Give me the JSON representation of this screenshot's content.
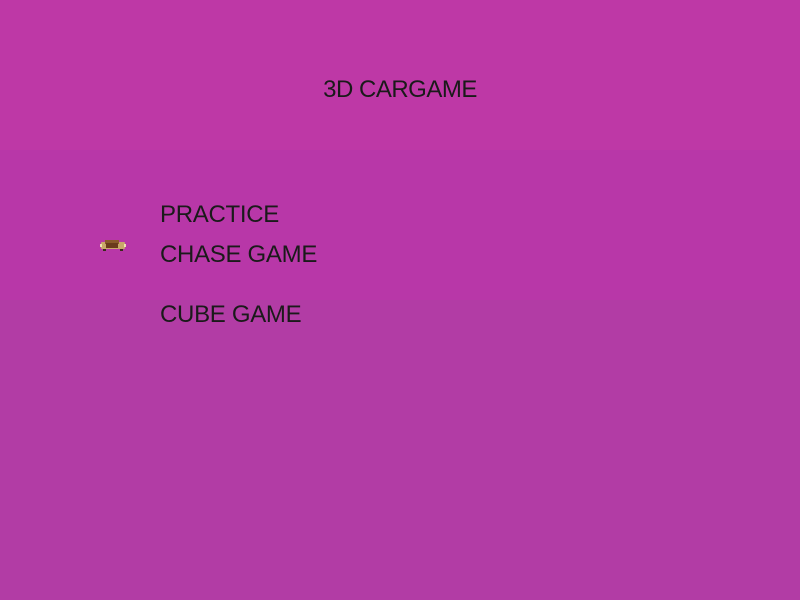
{
  "game": {
    "title": "3D CARGAME"
  },
  "menu": {
    "items": [
      {
        "label": "PRACTICE"
      },
      {
        "label": "CHASE GAME"
      },
      {
        "label": "CUBE GAME"
      }
    ],
    "selected_label": "CHASE GAME",
    "cursor_icon": "car-icon"
  },
  "colors": {
    "background": "#b53aa5",
    "text": "#1a1a1a"
  }
}
